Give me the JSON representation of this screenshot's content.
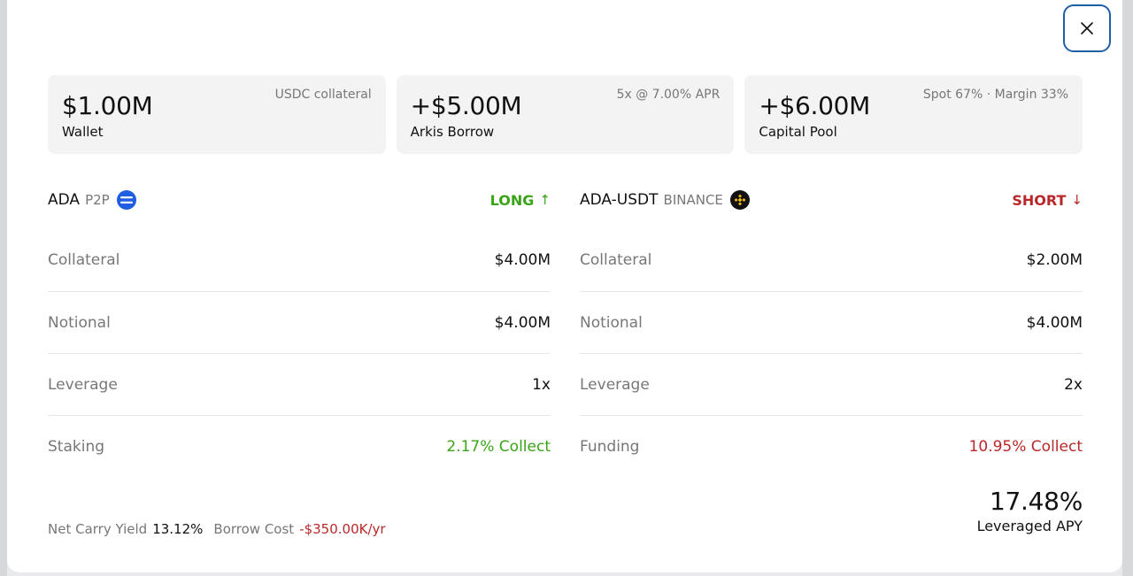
{
  "close": {
    "icon": "close-icon"
  },
  "summary": [
    {
      "amount": "$1.00M",
      "label": "Wallet",
      "note": "USDC collateral"
    },
    {
      "amount": "+$5.00M",
      "label": "Arkis Borrow",
      "note": "5x @ 7.00% APR"
    },
    {
      "amount": "+$6.00M",
      "label": "Capital Pool",
      "note": "Spot 67% · Margin 33%"
    }
  ],
  "legs": {
    "long": {
      "asset": "ADA",
      "venue": "P2P",
      "venue_icon": "p2p-icon",
      "direction": "LONG",
      "arrow": "↑",
      "rows": [
        {
          "label": "Collateral",
          "value": "$4.00M"
        },
        {
          "label": "Notional",
          "value": "$4.00M"
        },
        {
          "label": "Leverage",
          "value": "1x"
        },
        {
          "label": "Staking",
          "value": "2.17% Collect"
        }
      ]
    },
    "short": {
      "asset": "ADA-USDT",
      "venue": "BINANCE",
      "venue_icon": "binance-icon",
      "direction": "SHORT",
      "arrow": "↓",
      "rows": [
        {
          "label": "Collateral",
          "value": "$2.00M"
        },
        {
          "label": "Notional",
          "value": "$4.00M"
        },
        {
          "label": "Leverage",
          "value": "2x"
        },
        {
          "label": "Funding",
          "value": "10.95% Collect"
        }
      ]
    }
  },
  "footer": {
    "net_carry_label": "Net Carry Yield",
    "net_carry_value": "13.12%",
    "borrow_cost_label": "Borrow Cost",
    "borrow_cost_value": "-$350.00K/yr",
    "apy_value": "17.48%",
    "apy_label": "Leveraged APY"
  },
  "colors": {
    "positive": "#3aa317",
    "negative": "#b8282a",
    "accent": "#1f5fa8"
  }
}
